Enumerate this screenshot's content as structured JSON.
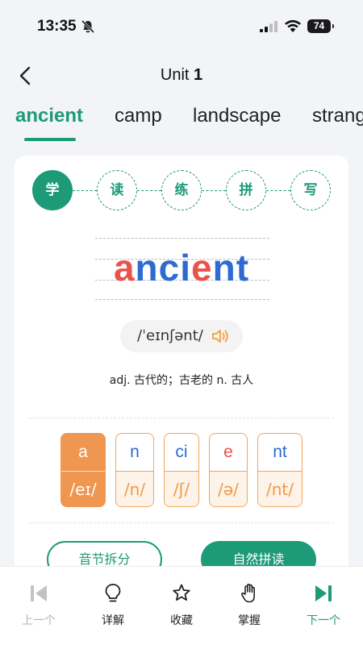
{
  "status_bar": {
    "time": "13:35",
    "battery": "74",
    "icons": [
      "bell-off-icon",
      "signal-icon",
      "wifi-icon",
      "battery-icon"
    ]
  },
  "header": {
    "title_prefix": "Unit ",
    "title_number": "1",
    "back_icon": "chevron-left-icon"
  },
  "word_tabs": [
    {
      "label": "ancient",
      "active": true
    },
    {
      "label": "camp",
      "active": false
    },
    {
      "label": "landscape",
      "active": false
    },
    {
      "label": "strang",
      "active": false
    }
  ],
  "steps": [
    {
      "label": "学",
      "active": true
    },
    {
      "label": "读",
      "active": false
    },
    {
      "label": "练",
      "active": false
    },
    {
      "label": "拼",
      "active": false
    },
    {
      "label": "写",
      "active": false
    }
  ],
  "word": {
    "segments": [
      {
        "text": "a",
        "color": "#e9534b"
      },
      {
        "text": "nci",
        "color": "#2d6bd2"
      },
      {
        "text": "e",
        "color": "#e9534b"
      },
      {
        "text": "nt",
        "color": "#2d6bd2"
      }
    ],
    "phonetic": "/ˈeɪnʃənt/",
    "definition": "adj. 古代的；古老的 n. 古人"
  },
  "syllables": [
    {
      "letters": "a",
      "sound": "/eɪ/",
      "color": "#ffffff",
      "active": true
    },
    {
      "letters": "n",
      "sound": "/n/",
      "color": "#2d6bd2",
      "active": false
    },
    {
      "letters": "ci",
      "sound": "/ʃ/",
      "color": "#2d6bd2",
      "active": false
    },
    {
      "letters": "e",
      "sound": "/ə/",
      "color": "#e9534b",
      "active": false
    },
    {
      "letters": "nt",
      "sound": "/nt/",
      "color": "#2d6bd2",
      "active": false
    }
  ],
  "actions": {
    "syllable_split": "音节拆分",
    "natural_phonics": "自然拼读"
  },
  "bottom_nav": [
    {
      "label": "上一个",
      "icon": "skip-back-icon",
      "state": "disabled"
    },
    {
      "label": "详解",
      "icon": "lightbulb-icon",
      "state": "normal"
    },
    {
      "label": "收藏",
      "icon": "star-icon",
      "state": "normal"
    },
    {
      "label": "掌握",
      "icon": "hand-icon",
      "state": "normal"
    },
    {
      "label": "下一个",
      "icon": "skip-forward-icon",
      "state": "next"
    }
  ],
  "colors": {
    "accent": "#1d9a78",
    "orange": "#ef9650",
    "red": "#e9534b",
    "blue": "#2d6bd2",
    "background": "#f2f4f7"
  }
}
